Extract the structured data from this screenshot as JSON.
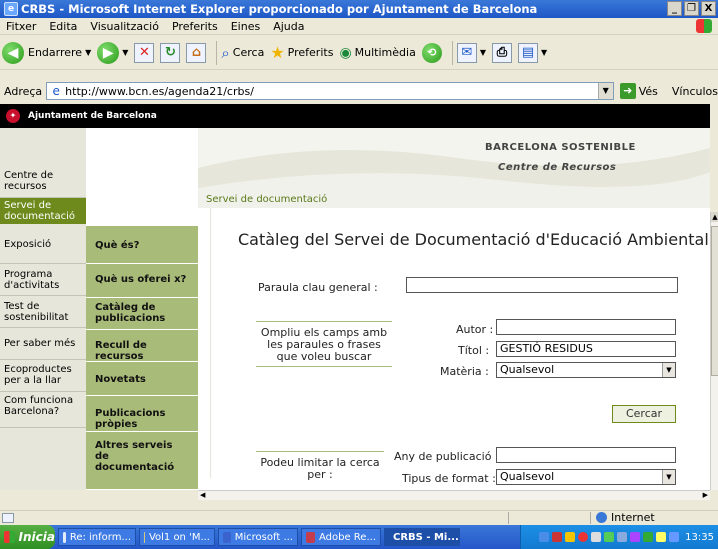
{
  "window": {
    "title": "CRBS - Microsoft Internet Explorer proporcionado por Ajuntament de Barcelona",
    "minimize": "_",
    "maximize": "❐",
    "close": "X"
  },
  "menu": [
    "Fitxer",
    "Edita",
    "Visualització",
    "Preferits",
    "Eines",
    "Ajuda"
  ],
  "toolbar": {
    "back": "Endarrere",
    "search": "Cerca",
    "favorites": "Preferits",
    "multimedia": "Multimèdia"
  },
  "address": {
    "label": "Adreça",
    "url": "http://www.bcn.es/agenda21/crbs/",
    "go": "Vés",
    "links": "Vínculos"
  },
  "site": {
    "org": "Ajuntament de Barcelona",
    "banner_line1": "BARCELONA SOSTENIBLE",
    "banner_line2": "Centre de Recursos",
    "breadcrumb": "Servei de documentació"
  },
  "sidebar": [
    "Centre de recursos",
    "Servei de documentació",
    "Exposició",
    "Programa d'activitats",
    "Test de sostenibilitat",
    "Per saber més",
    "Ecoproductes per a la llar",
    "Com funciona Barcelona?"
  ],
  "subnav": [
    "Què és?",
    "Què us oferei x?",
    "Catàleg de publicacions",
    "Recull de recursos",
    "Novetats",
    "Publicacions pròpies",
    "Altres serveis de documentació"
  ],
  "form": {
    "title": "Catàleg del Servei de Documentació d'Educació Ambiental",
    "keyword_label": "Paraula clau general :",
    "keyword_value": "",
    "hint": "Ompliu els camps amb les paraules o frases que voleu buscar",
    "author_label": "Autor :",
    "author_value": "",
    "title_label": "Títol :",
    "title_value": "GESTIÓ RESIDUS",
    "subject_label": "Matèria :",
    "subject_value": "Qualsevol",
    "search_button": "Cercar",
    "limit_hint": "Podeu limitar la cerca per :",
    "year_label": "Any de publicació :",
    "year_value": "",
    "format_label": "Tipus de format :",
    "format_value": "Qualsevol"
  },
  "status": {
    "zone": "Internet"
  },
  "taskbar": {
    "start": "Inicia",
    "tasks": [
      "Re: inform...",
      "Vol1 on 'M...",
      "Microsoft ...",
      "Adobe Re...",
      "CRBS - Mi..."
    ],
    "clock": "13:35"
  }
}
